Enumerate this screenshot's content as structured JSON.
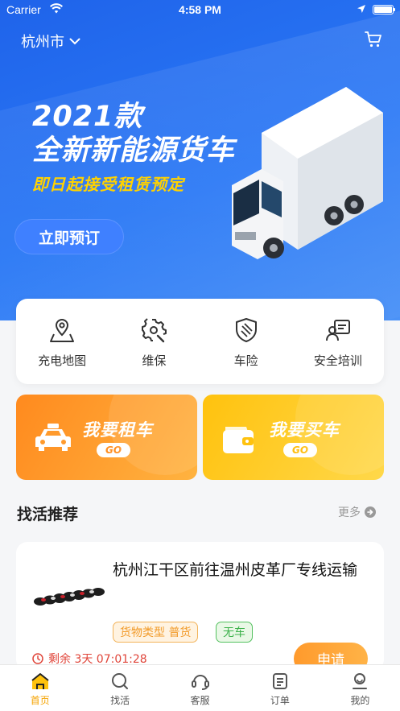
{
  "status_bar": {
    "carrier": "Carrier",
    "time": "4:58 PM"
  },
  "header": {
    "city": "杭州市"
  },
  "banner": {
    "title_line1": "2021款",
    "title_line2": "全新新能源货车",
    "subtitle": "即日起接受租赁预定",
    "button": "立即预订"
  },
  "services": [
    {
      "label": "充电地图",
      "icon": "map-pin-icon"
    },
    {
      "label": "维保",
      "icon": "gear-wrench-icon"
    },
    {
      "label": "车险",
      "icon": "shield-icon"
    },
    {
      "label": "安全培训",
      "icon": "training-icon"
    }
  ],
  "actions": {
    "rent": {
      "title": "我要租车",
      "go": "GO",
      "icon": "car-icon"
    },
    "buy": {
      "title": "我要买车",
      "go": "GO",
      "icon": "wallet-icon"
    }
  },
  "section": {
    "title": "找活推荐",
    "more": "更多"
  },
  "job": {
    "title": "杭州江干区前往温州皮革厂专线运输",
    "tag_type": "货物类型 普货",
    "tag_vehicle": "无车",
    "remaining": "剩余 3天 07:01:28",
    "apply": "申请"
  },
  "tabs": [
    {
      "label": "首页",
      "icon": "home-icon",
      "active": true
    },
    {
      "label": "找活",
      "icon": "search-icon",
      "active": false
    },
    {
      "label": "客服",
      "icon": "headset-icon",
      "active": false
    },
    {
      "label": "订单",
      "icon": "orders-icon",
      "active": false
    },
    {
      "label": "我的",
      "icon": "profile-icon",
      "active": false
    }
  ],
  "colors": {
    "hero_blue": "#2a78f5",
    "accent_orange": "#ff8a1e",
    "accent_yellow": "#ffc20e",
    "active_tab": "#f5a300",
    "countdown_red": "#e0453a"
  }
}
